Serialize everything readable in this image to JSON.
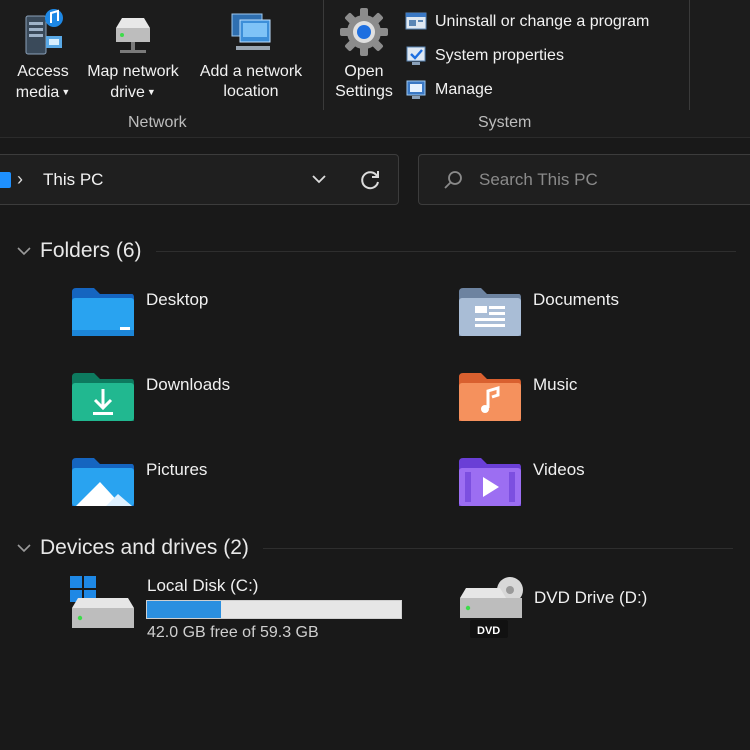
{
  "ribbon": {
    "network": {
      "label": "Network",
      "buttons": [
        {
          "line1": "Access",
          "line2": "media",
          "icon": "media-server-icon",
          "has_dropdown": true
        },
        {
          "line1": "Map network",
          "line2": "drive",
          "icon": "network-drive-icon",
          "has_dropdown": true
        },
        {
          "line1": "Add a network",
          "line2": "location",
          "icon": "network-location-icon",
          "has_dropdown": false
        }
      ]
    },
    "system": {
      "label": "System",
      "open_settings": {
        "line1": "Open",
        "line2": "Settings",
        "icon": "gear-icon"
      },
      "items": [
        {
          "label": "Uninstall or change a program",
          "icon": "uninstall-program-icon"
        },
        {
          "label": "System properties",
          "icon": "system-properties-icon"
        },
        {
          "label": "Manage",
          "icon": "computer-management-icon"
        }
      ]
    }
  },
  "address_bar": {
    "breadcrumb": "This PC",
    "icon": "this-pc-icon"
  },
  "search": {
    "placeholder": "Search This PC"
  },
  "folders": {
    "heading": "Folders (6)",
    "items": [
      {
        "label": "Desktop",
        "icon": "desktop-folder-icon",
        "color": "#1e88e5"
      },
      {
        "label": "Documents",
        "icon": "documents-folder-icon",
        "color": "#8fa7c4"
      },
      {
        "label": "Downloads",
        "icon": "downloads-folder-icon",
        "color": "#1aa784"
      },
      {
        "label": "Music",
        "icon": "music-folder-icon",
        "color": "#f0794f"
      },
      {
        "label": "Pictures",
        "icon": "pictures-folder-icon",
        "color": "#1e88e5"
      },
      {
        "label": "Videos",
        "icon": "videos-folder-icon",
        "color": "#8b5cf6"
      }
    ]
  },
  "drives": {
    "heading": "Devices and drives (2)",
    "items": [
      {
        "label": "Local Disk (C:)",
        "icon": "local-disk-icon",
        "free_text": "42.0 GB free of 59.3 GB",
        "used_fraction": 0.29
      },
      {
        "label": "DVD Drive (D:)",
        "icon": "dvd-drive-icon",
        "badge": "DVD"
      }
    ]
  },
  "colors": {
    "background": "#191919",
    "accent": "#2a8fe0"
  }
}
